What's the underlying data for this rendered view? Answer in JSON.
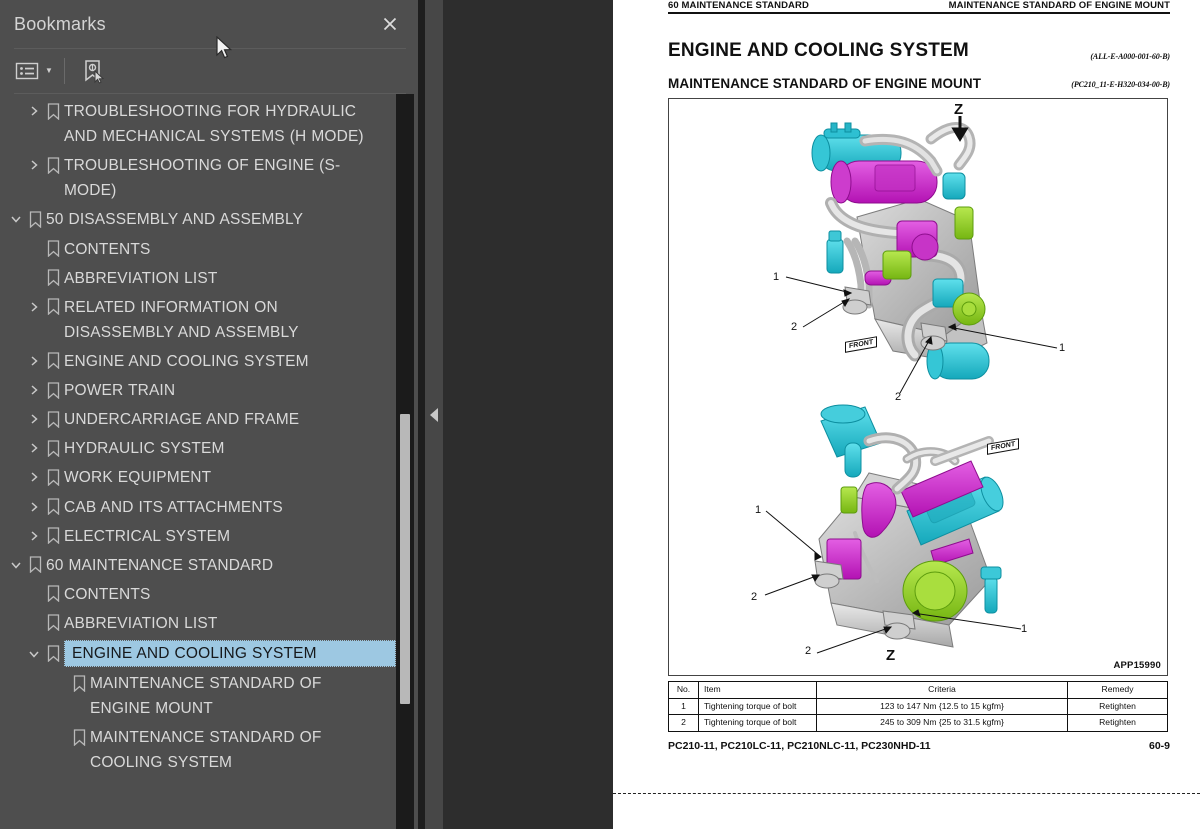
{
  "panel": {
    "title": "Bookmarks",
    "close_label": "×",
    "toolbar": {
      "options_icon": "list-options-icon",
      "caret_icon": "chevron-down-icon",
      "new_bookmark_icon": "new-bookmark-icon"
    }
  },
  "tree": {
    "items": [
      {
        "label": "TROUBLESHOOTING FOR HYDRAULIC AND MECHANICAL SYSTEMS (H MODE)",
        "depth": 1,
        "twisty": "collapsed",
        "selected": false
      },
      {
        "label": "TROUBLESHOOTING OF ENGINE (S-MODE)",
        "depth": 1,
        "twisty": "collapsed",
        "selected": false
      },
      {
        "label": "50 DISASSEMBLY AND ASSEMBLY",
        "depth": 0,
        "twisty": "expanded",
        "selected": false
      },
      {
        "label": "CONTENTS",
        "depth": 1,
        "twisty": "none",
        "selected": false
      },
      {
        "label": "ABBREVIATION LIST",
        "depth": 1,
        "twisty": "none",
        "selected": false
      },
      {
        "label": "RELATED INFORMATION ON DISASSEMBLY AND ASSEMBLY",
        "depth": 1,
        "twisty": "collapsed",
        "selected": false
      },
      {
        "label": "ENGINE AND COOLING SYSTEM",
        "depth": 1,
        "twisty": "collapsed",
        "selected": false
      },
      {
        "label": "POWER TRAIN",
        "depth": 1,
        "twisty": "collapsed",
        "selected": false
      },
      {
        "label": "UNDERCARRIAGE AND FRAME",
        "depth": 1,
        "twisty": "collapsed",
        "selected": false
      },
      {
        "label": "HYDRAULIC SYSTEM",
        "depth": 1,
        "twisty": "collapsed",
        "selected": false
      },
      {
        "label": "WORK EQUIPMENT",
        "depth": 1,
        "twisty": "collapsed",
        "selected": false
      },
      {
        "label": "CAB AND ITS ATTACHMENTS",
        "depth": 1,
        "twisty": "collapsed",
        "selected": false
      },
      {
        "label": "ELECTRICAL SYSTEM",
        "depth": 1,
        "twisty": "collapsed",
        "selected": false
      },
      {
        "label": "60 MAINTENANCE STANDARD",
        "depth": 0,
        "twisty": "expanded",
        "selected": false
      },
      {
        "label": "CONTENTS",
        "depth": 1,
        "twisty": "none",
        "selected": false
      },
      {
        "label": "ABBREVIATION LIST",
        "depth": 1,
        "twisty": "none",
        "selected": false
      },
      {
        "label": "ENGINE AND COOLING SYSTEM",
        "depth": 1,
        "twisty": "expanded",
        "selected": true
      },
      {
        "label": "MAINTENANCE STANDARD OF ENGINE MOUNT",
        "depth": 2,
        "twisty": "none",
        "selected": false
      },
      {
        "label": "MAINTENANCE STANDARD OF COOLING SYSTEM",
        "depth": 2,
        "twisty": "none",
        "selected": false
      }
    ]
  },
  "viewer": {
    "collapse_icon": "collapse-left-arrow-icon"
  },
  "document": {
    "header_left": "60 MAINTENANCE STANDARD",
    "header_right": "MAINTENANCE STANDARD OF ENGINE MOUNT",
    "title": "ENGINE AND COOLING SYSTEM",
    "title_code": "(ALL-E-A000-001-60-B)",
    "subtitle": "MAINTENANCE STANDARD OF ENGINE MOUNT",
    "subtitle_code": "(PC210_11-E-H320-034-00-B)",
    "figure": {
      "code": "APP15990",
      "callouts_top": [
        "1",
        "2",
        "1",
        "2"
      ],
      "callouts_bottom": [
        "1",
        "2",
        "1",
        "2"
      ],
      "view_marker_top": "Z",
      "view_marker_bottom": "Z",
      "orientation_tag": "FRONT"
    },
    "table": {
      "headers": [
        "No.",
        "Item",
        "Criteria",
        "Remedy"
      ],
      "rows": [
        [
          "1",
          "Tightening torque of bolt",
          "123 to 147 Nm {12.5 to 15 kgfm}",
          "Retighten"
        ],
        [
          "2",
          "Tightening torque of bolt",
          "245 to 309 Nm {25 to 31.5 kgfm}",
          "Retighten"
        ]
      ]
    },
    "footer_left": "PC210-11, PC210LC-11, PC210NLC-11, PC230NHD-11",
    "footer_right": "60-9"
  },
  "colors": {
    "panel_bg": "#4e4e4e",
    "selection": "#9dc8e2",
    "viewer_bg": "#2d2d2d",
    "accent_cyan": "#2ec8d8",
    "accent_magenta": "#d21fd2",
    "accent_green": "#8ecf1e"
  }
}
